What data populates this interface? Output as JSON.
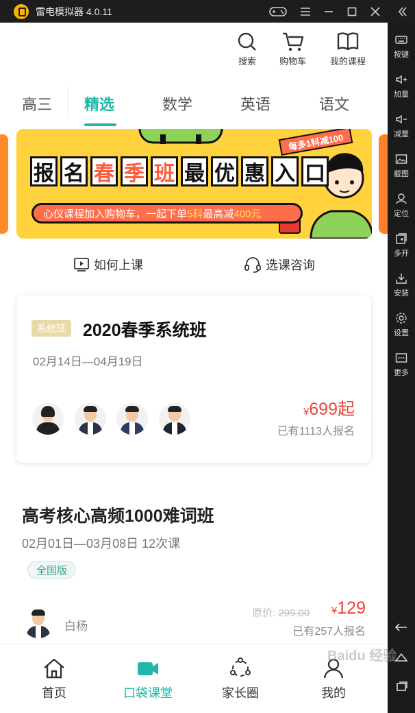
{
  "titlebar": {
    "app_name": "雷电模拟器 4.0.11"
  },
  "sidebar": {
    "items": [
      {
        "label": "按键"
      },
      {
        "label": "加量"
      },
      {
        "label": "减量"
      },
      {
        "label": "截图"
      },
      {
        "label": "定位"
      },
      {
        "label": "多开"
      },
      {
        "label": "安装"
      },
      {
        "label": "设置"
      },
      {
        "label": "更多"
      }
    ]
  },
  "header": {
    "search_label": "搜索",
    "cart_label": "购物车",
    "my_courses_label": "我的课程"
  },
  "tabs": {
    "grade": "高三",
    "items": [
      {
        "label": "精选",
        "active": true
      },
      {
        "label": "数学"
      },
      {
        "label": "英语"
      },
      {
        "label": "语文"
      }
    ]
  },
  "banner": {
    "headline": [
      "报",
      "名",
      "春",
      "季",
      "班",
      "最",
      "优",
      "惠",
      "入",
      "口"
    ],
    "tag": "每多1科减100",
    "subline_a": "心仪课程加入购物车，一起下单",
    "subline_b": "5科",
    "subline_c": "最高减",
    "subline_d": "400元"
  },
  "quicklinks": {
    "how_to_attend": "如何上课",
    "consult": "选课咨询"
  },
  "featured": {
    "badge": "系统班",
    "title": "2020春季系统班",
    "dates": "02月14日—04月19日",
    "currency": "¥",
    "price": "699起",
    "enrolled": "已有1113人报名"
  },
  "course2": {
    "title": "高考核心高频1000难词班",
    "dates": "02月01日—03月08日  12次课",
    "tag": "全国版",
    "teacher": "白杨",
    "orig_label": "原价:",
    "orig_price": "299.00",
    "currency": "¥",
    "price": "129",
    "enrolled": "已有257人报名"
  },
  "bottomnav": {
    "items": [
      {
        "label": "首页"
      },
      {
        "label": "口袋课堂",
        "active": true
      },
      {
        "label": "家长圈"
      },
      {
        "label": "我的"
      }
    ]
  },
  "watermark": "Baidu 经验",
  "colors": {
    "accent": "#1fb8a8",
    "price": "#e8473c",
    "banner_bg": "#ffd23e"
  }
}
